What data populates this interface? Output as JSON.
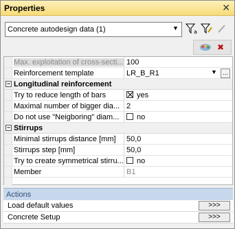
{
  "title": "Properties",
  "toolbar": {
    "dataset_select": "Concrete autodesign data (1)"
  },
  "properties": {
    "max_exploitation": {
      "name": "Max. exploitation of cross-secti...",
      "value": "100"
    },
    "reinforcement_template": {
      "name": "Reinforcement template",
      "value": "LR_B_R1"
    },
    "longitudinal": {
      "label": "Longitudinal reinforcement",
      "reduce_length": {
        "name": "Try to reduce length of bars",
        "value": "yes"
      },
      "max_bigger": {
        "name": "Maximal number of bigger dia...",
        "value": "2"
      },
      "neighboring": {
        "name": "Do not use \"Neigboring\" diam...",
        "value": "no"
      }
    },
    "stirrups": {
      "label": "Stirrups",
      "min_distance": {
        "name": "Minimal stirrups distance [mm]",
        "value": "50,0"
      },
      "step": {
        "name": "Stirrups step [mm]",
        "value": "50,0"
      },
      "symmetrical": {
        "name": "Try to create symmetrical stirru...",
        "value": "no"
      }
    },
    "member": {
      "name": "Member",
      "value": "B1"
    }
  },
  "actions": {
    "header": "Actions",
    "items": [
      {
        "label": "Load default values",
        "button": ">>>"
      },
      {
        "label": "Concrete Setup",
        "button": ">>>"
      }
    ]
  },
  "colors": {
    "title_bar": "#f7dc79",
    "actions_header": "#c8d8ec"
  }
}
